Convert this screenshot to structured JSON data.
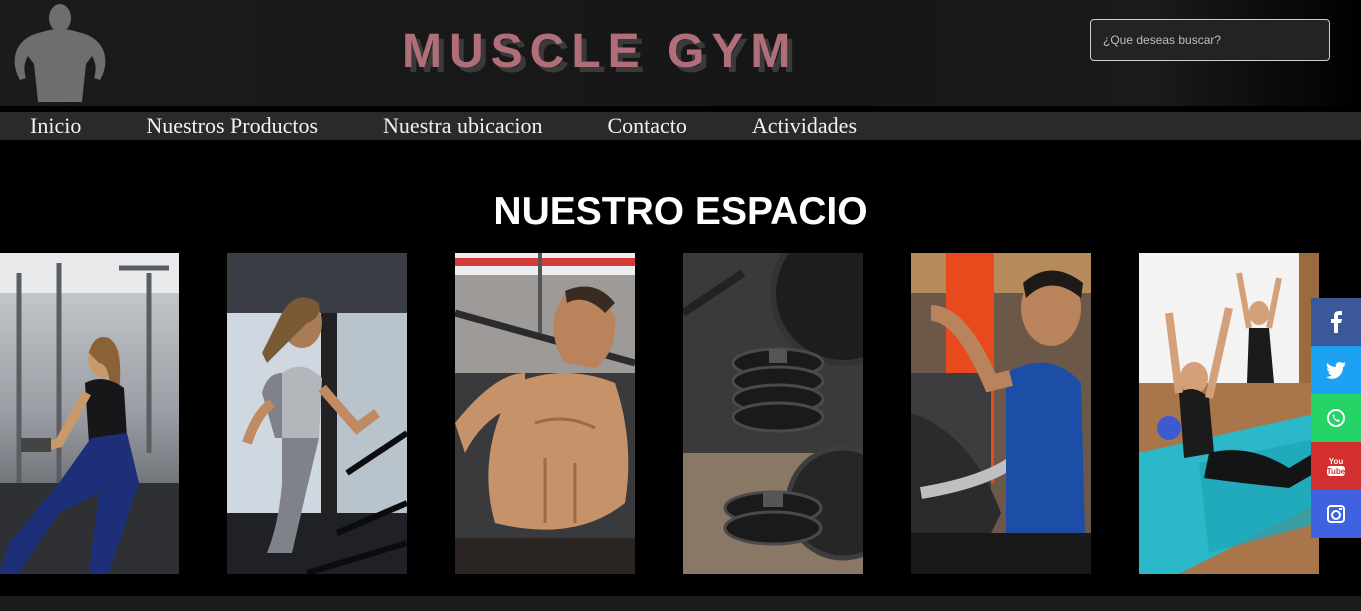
{
  "header": {
    "brand": "MUSCLE GYM",
    "search_placeholder": "¿Que deseas buscar?"
  },
  "nav": {
    "items": [
      {
        "label": "Inicio"
      },
      {
        "label": "Nuestros Productos"
      },
      {
        "label": "Nuestra ubicacion"
      },
      {
        "label": "Contacto"
      },
      {
        "label": "Actividades"
      }
    ]
  },
  "main": {
    "title": "NUESTRO ESPACIO",
    "gallery": [
      {
        "subject": "woman-rowing-machine"
      },
      {
        "subject": "woman-treadmill"
      },
      {
        "subject": "man-lat-pulldown"
      },
      {
        "subject": "weight-plates"
      },
      {
        "subject": "man-chest-machine"
      },
      {
        "subject": "women-pilates-class"
      }
    ]
  },
  "social": {
    "items": [
      {
        "icon": "facebook-icon",
        "glyph": "f",
        "color": "#3b5998"
      },
      {
        "icon": "twitter-icon",
        "glyph": "t",
        "color": "#1da1f2"
      },
      {
        "icon": "whatsapp-icon",
        "glyph": "✆",
        "color": "#25d366"
      },
      {
        "icon": "youtube-icon",
        "glyph": "You",
        "color": "#d32f2f"
      },
      {
        "icon": "instagram-icon",
        "glyph": "◎",
        "color": "#3f63e0"
      }
    ]
  },
  "colors": {
    "brand": "#b06e78",
    "nav_bg": "#2a2a2a",
    "page_bg": "#000000"
  }
}
